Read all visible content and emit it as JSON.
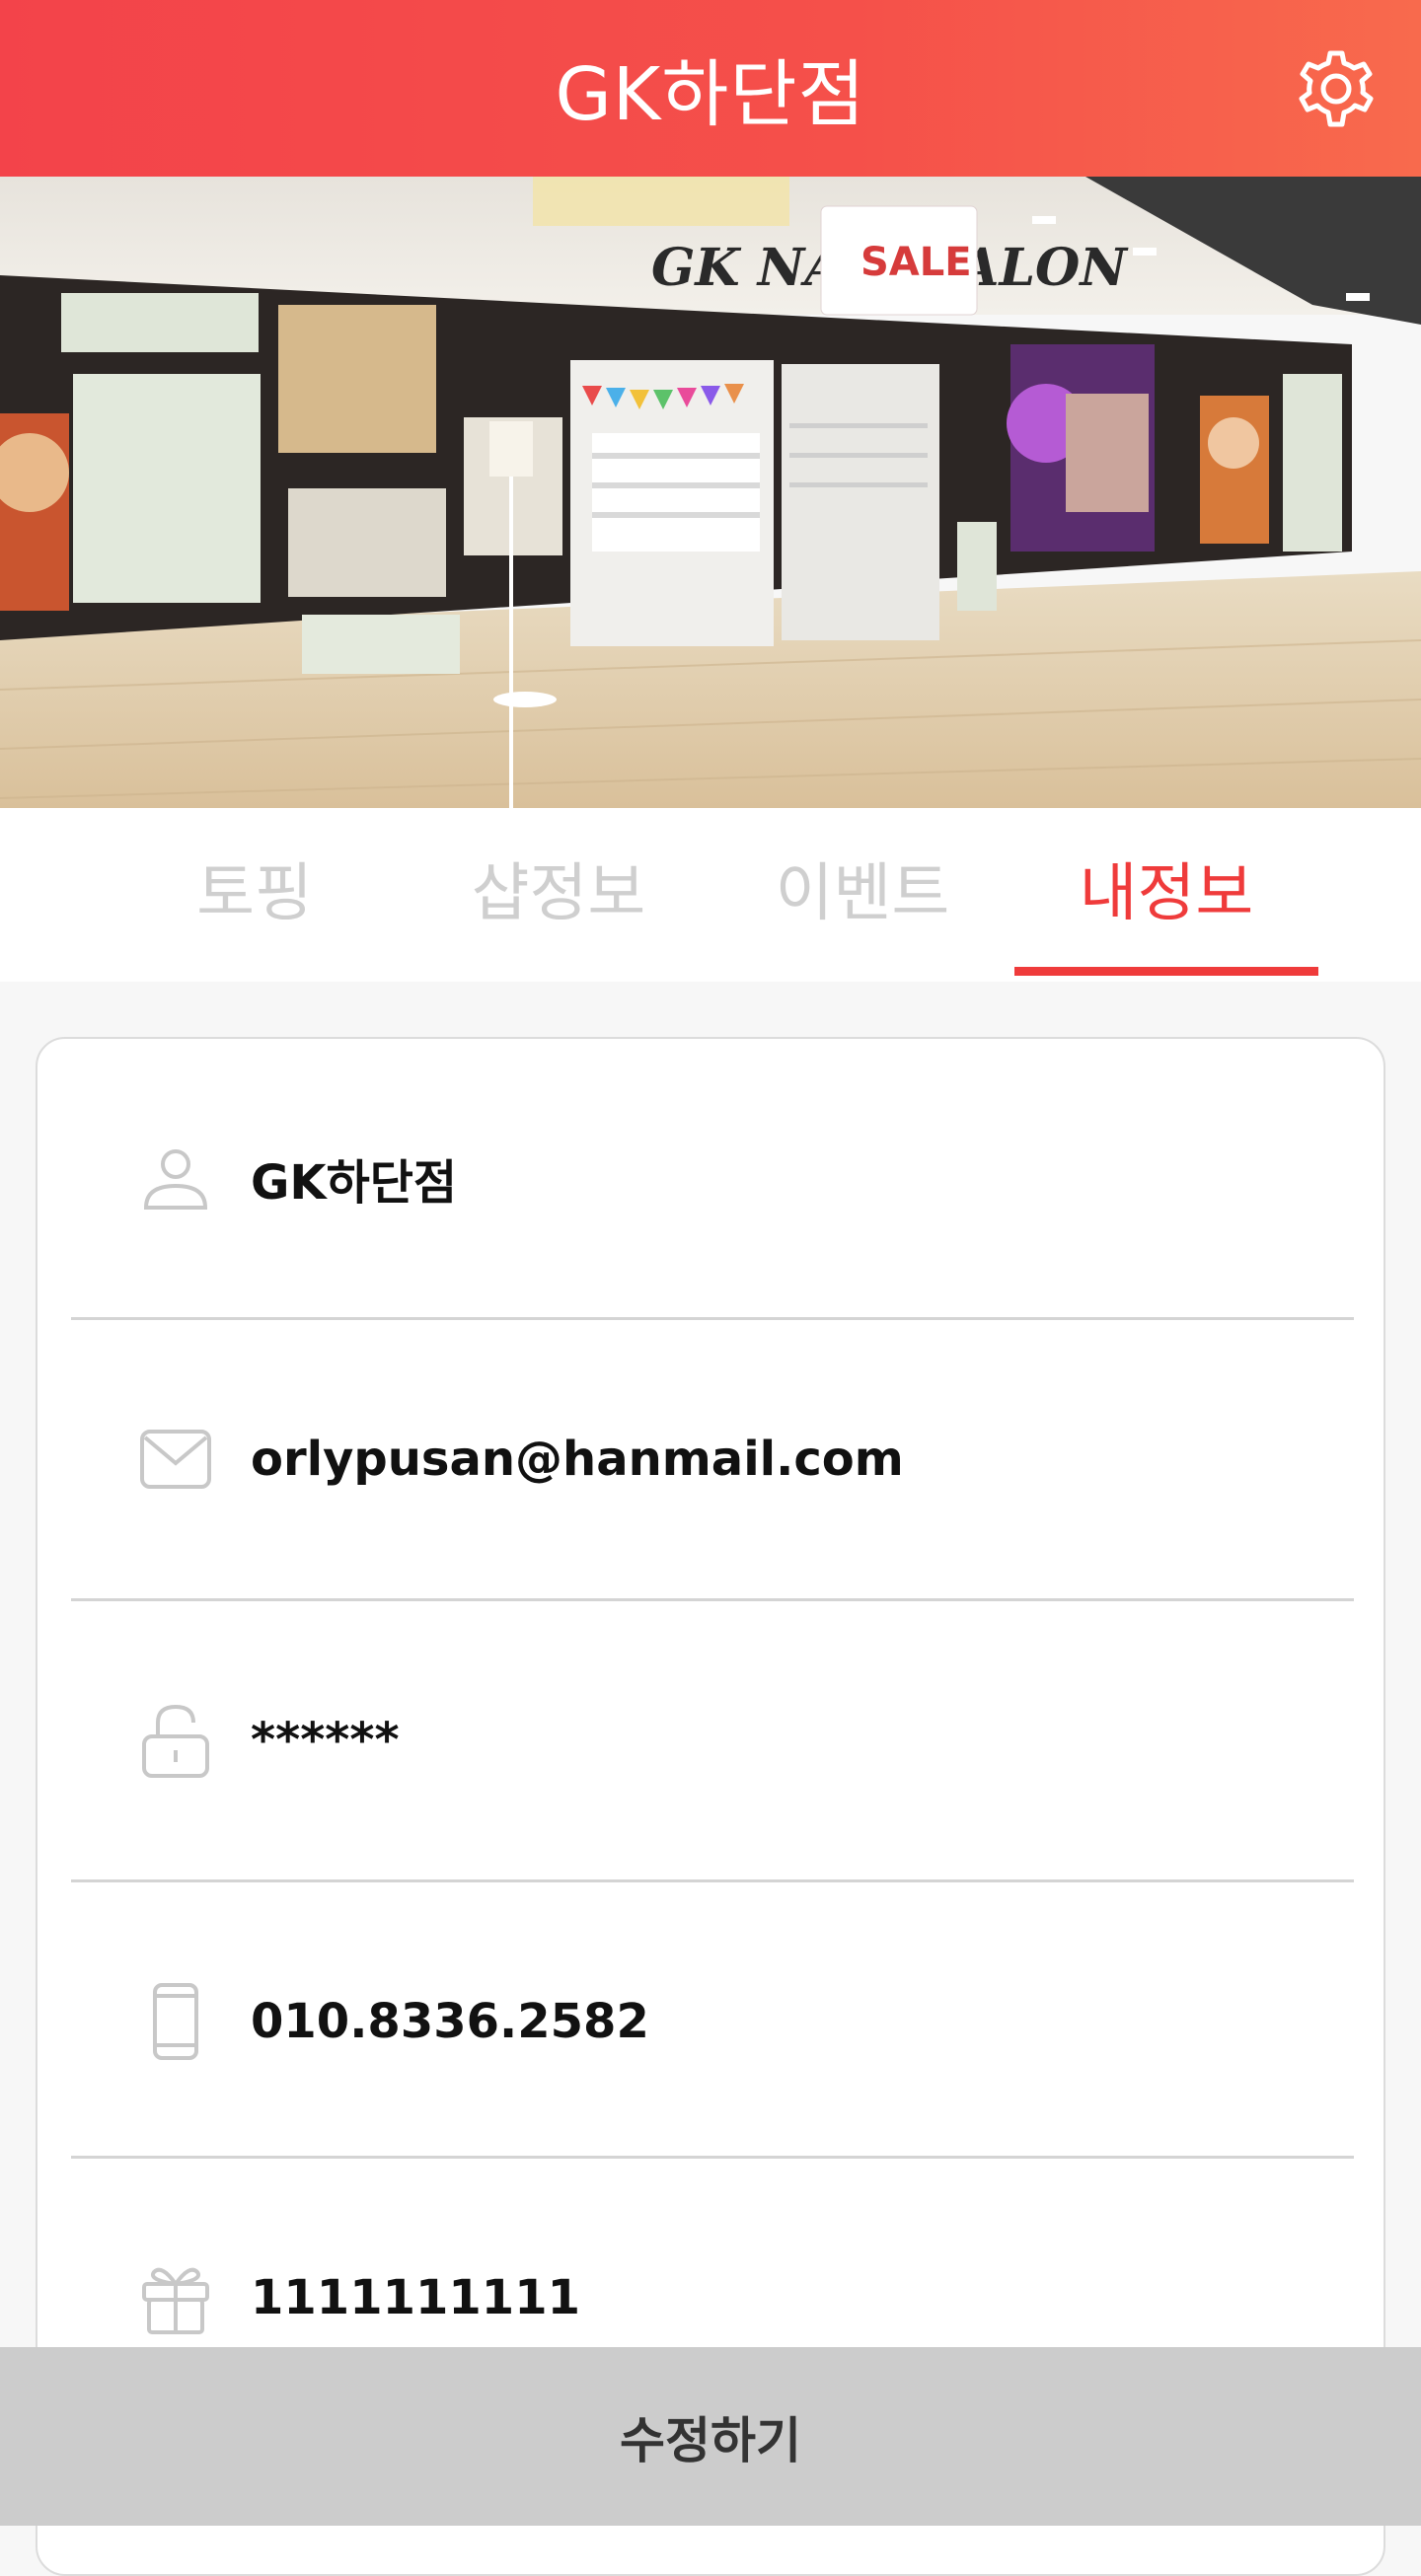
{
  "header": {
    "title": "GK하단점",
    "settings_icon": "gear-icon"
  },
  "hero": {
    "sign_text": "GK NAIL SALON",
    "sale_text": "SALE"
  },
  "tabs": [
    {
      "label": "토핑",
      "active": false
    },
    {
      "label": "샵정보",
      "active": false
    },
    {
      "label": "이벤트",
      "active": false
    },
    {
      "label": "내정보",
      "active": true
    }
  ],
  "profile": {
    "fields": [
      {
        "icon": "user-icon",
        "value": "GK하단점"
      },
      {
        "icon": "mail-icon",
        "value": "orlypusan@hanmail.com"
      },
      {
        "icon": "lock-icon",
        "value": "******"
      },
      {
        "icon": "phone-icon",
        "value": "010.8336.2582"
      },
      {
        "icon": "gift-icon",
        "value": "1111111111"
      }
    ]
  },
  "footer": {
    "edit_label": "수정하기"
  },
  "colors": {
    "accent": "#ef3b3b",
    "header_start": "#f3434a",
    "header_end": "#f86a4d",
    "tab_inactive": "#cfcfcf",
    "bottom_button": "#cccccc"
  }
}
